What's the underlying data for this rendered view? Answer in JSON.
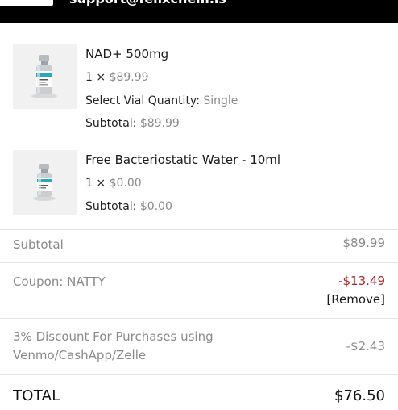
{
  "header": {
    "email": "support@felixchem.is"
  },
  "items": [
    {
      "title": "NAD+ 500mg",
      "qty": "1",
      "times": "×",
      "price": "$89.99",
      "option_label": "Select Vial Quantity:",
      "option_value": "Single",
      "subtotal_label": "Subtotal:",
      "subtotal_value": "$89.99"
    },
    {
      "title": "Free Bacteriostatic Water - 10ml",
      "qty": "1",
      "times": "×",
      "price": "$0.00",
      "subtotal_label": "Subtotal:",
      "subtotal_value": "$0.00"
    }
  ],
  "totals": {
    "subtotal_label": "Subtotal",
    "subtotal_value": "$89.99",
    "coupon_label": "Coupon: NATTY",
    "coupon_value": "-$13.49",
    "remove_label": "[Remove]",
    "discount_label_line1": "3% Discount For Purchases using",
    "discount_label_line2": "Venmo/CashApp/Zelle",
    "discount_value": "-$2.43",
    "total_label": "TOTAL",
    "total_value": "$76.50"
  },
  "colors": {
    "header_bg": "#000000",
    "coupon": "#b22222",
    "muted": "#8a8a8a"
  }
}
